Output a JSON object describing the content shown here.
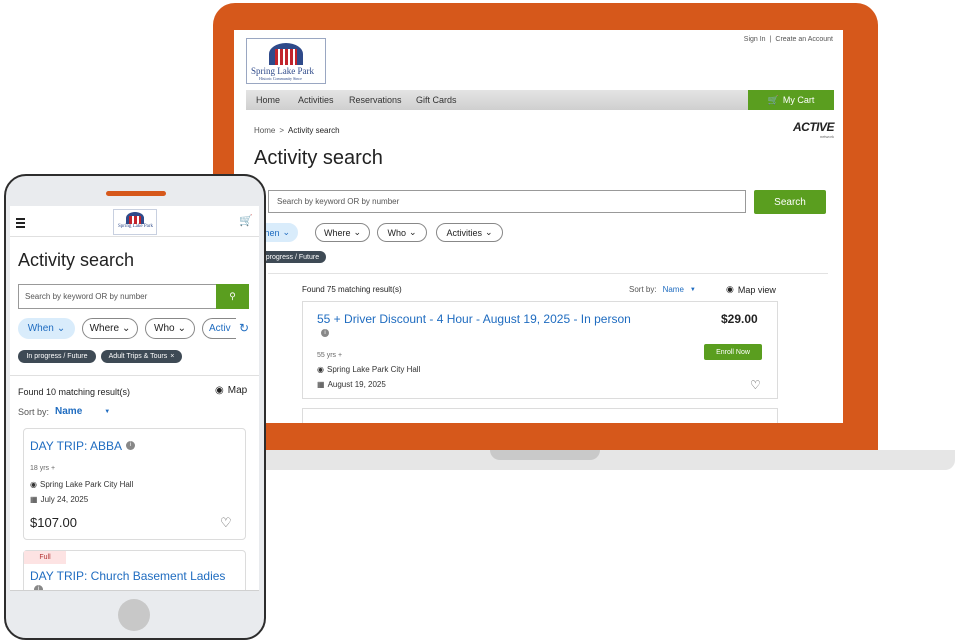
{
  "brand": {
    "name": "Spring Lake Park",
    "tagline": "Historic Community Since",
    "colors": {
      "accent": "#d6581b",
      "green": "#5a9e1f",
      "link": "#1f6cc0",
      "navy": "#2f4a8a"
    }
  },
  "desktop": {
    "header": {
      "sign_in": "Sign In",
      "separator": "|",
      "create_account": "Create an Account"
    },
    "nav": {
      "items": [
        "Home",
        "Activities",
        "Reservations",
        "Gift Cards"
      ],
      "cart": "My Cart"
    },
    "breadcrumb": {
      "home": "Home",
      "sep": ">",
      "current": "Activity search"
    },
    "partner_logo": {
      "main": "ACTIVE",
      "sub": "network"
    },
    "title": "Activity search",
    "search": {
      "placeholder": "Search by keyword OR by number",
      "button": "Search"
    },
    "filters": [
      "When",
      "Where",
      "Who",
      "Activities"
    ],
    "chip": "In progress / Future",
    "results": {
      "found": "Found 75 matching result(s)",
      "sort_label": "Sort by:",
      "sort_value": "Name",
      "map_view": "Map view"
    },
    "card": {
      "title": "55 + Driver Discount - 4 Hour - August 19, 2025 - In person",
      "price": "$29.00",
      "age": "55 yrs +",
      "location": "Spring Lake Park City Hall",
      "date": "August 19, 2025",
      "enroll": "Enroll Now"
    }
  },
  "mobile": {
    "title": "Activity search",
    "search": {
      "placeholder": "Search by keyword OR by number",
      "button_icon": "search-icon"
    },
    "filters": [
      "When",
      "Where",
      "Who",
      "Activ"
    ],
    "chips": [
      "In progress / Future",
      "Adult Trips & Tours"
    ],
    "results": {
      "found": "Found 10 matching result(s)",
      "map": "Map",
      "sort_label": "Sort by:",
      "sort_value": "Name"
    },
    "card1": {
      "title": "DAY TRIP: ABBA",
      "age": "18 yrs +",
      "location": "Spring Lake Park City Hall",
      "date": "July 24, 2025",
      "price": "$107.00"
    },
    "card2": {
      "badge": "Full",
      "title": "DAY TRIP: Church Basement Ladies"
    }
  }
}
